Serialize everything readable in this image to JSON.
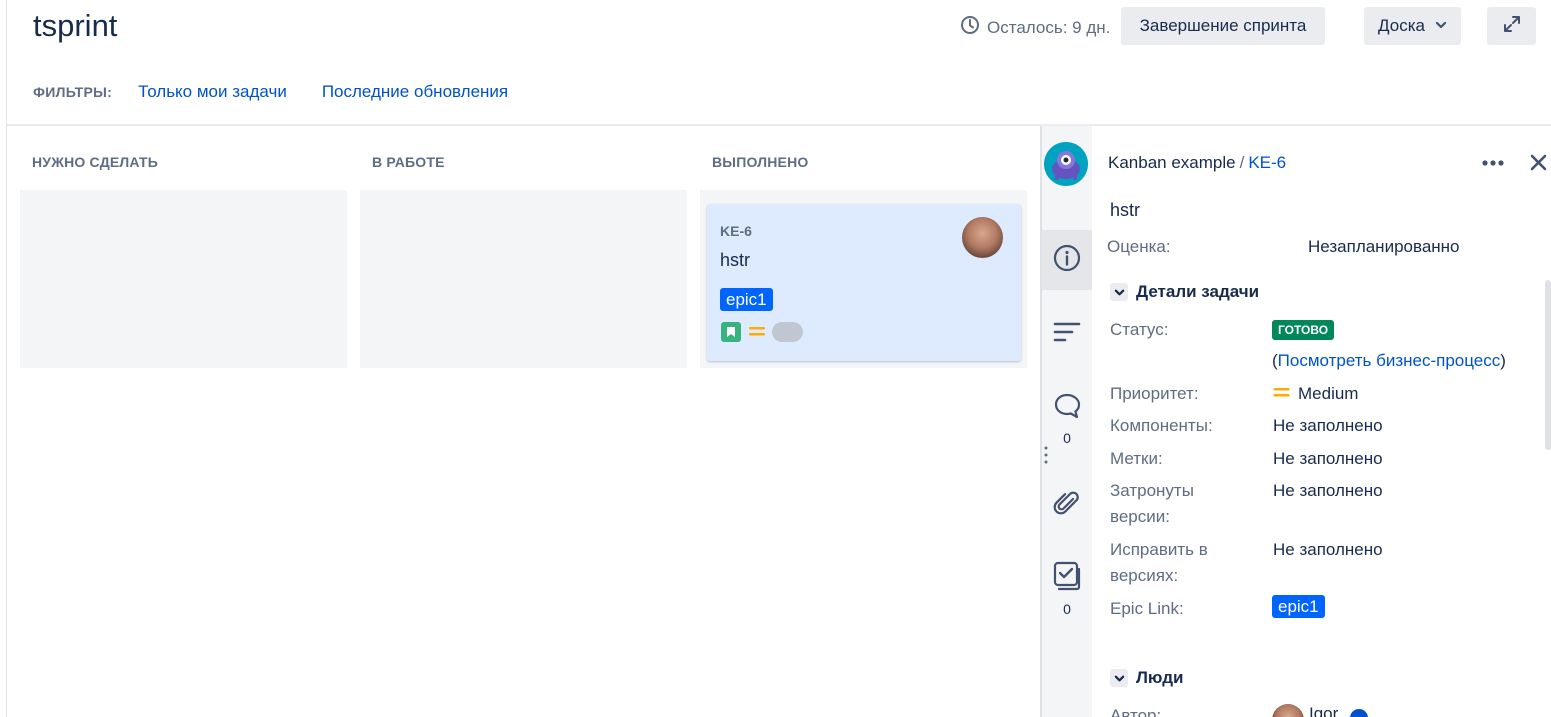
{
  "header": {
    "title": "tsprint",
    "remaining": "Осталось: 9 дн.",
    "complete_sprint": "Завершение спринта",
    "board_menu": "Доска"
  },
  "filters": {
    "label": "ФИЛЬТРЫ:",
    "items": [
      "Только мои задачи",
      "Последние обновления"
    ]
  },
  "board": {
    "columns": [
      "НУЖНО СДЕЛАТЬ",
      "В РАБОТЕ",
      "ВЫПОЛНЕНО"
    ],
    "card": {
      "key": "KE-6",
      "summary": "hstr",
      "epic": "epic1",
      "priority_color": "#ffab00",
      "issue_type_color": "#36b37e"
    }
  },
  "rail": {
    "comments_count": "0",
    "checklist_count": "0"
  },
  "detail": {
    "project": "Kanban example",
    "separator": "/",
    "issue_key": "KE-6",
    "summary": "hstr",
    "estimate_label": "Оценка:",
    "estimate_value": "Незапланированно",
    "details_section": "Детали задачи",
    "fields": {
      "status_label": "Статус:",
      "status_value": "ГОТОВО",
      "workflow_open": "(",
      "workflow_link": "Посмотреть бизнес-процесс",
      "workflow_close": ")",
      "priority_label": "Приоритет:",
      "priority_value": "Medium",
      "components_label": "Компоненты:",
      "components_value": "Не заполнено",
      "labels_label": "Метки:",
      "labels_value": "Не заполнено",
      "affects_label_1": "Затронуты",
      "affects_label_2": "версии:",
      "affects_value": "Не заполнено",
      "fix_label_1": "Исправить в",
      "fix_label_2": "версиях:",
      "fix_value": "Не заполнено",
      "epic_link_label": "Epic Link:",
      "epic_link_value": "epic1"
    },
    "people_section": "Люди",
    "author_label": "Автор:",
    "author_name": "Igor"
  },
  "colors": {
    "accent": "#0052cc",
    "epic": "#0065ff",
    "done": "#00875a"
  }
}
